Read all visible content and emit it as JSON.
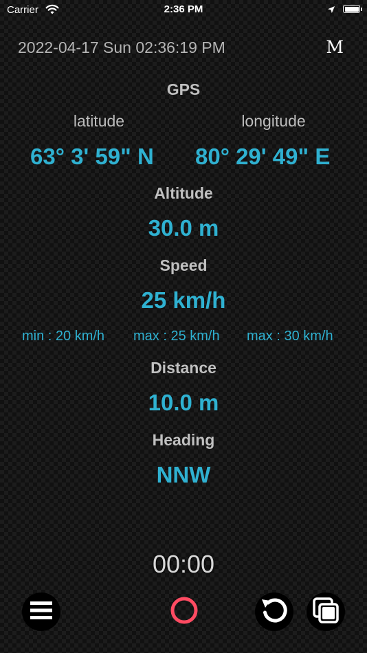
{
  "status_bar": {
    "carrier": "Carrier",
    "time": "2:36 PM"
  },
  "header": {
    "datetime": "2022-04-17 Sun 02:36:19 PM",
    "mode_button": "M"
  },
  "gps": {
    "title": "GPS",
    "latitude_label": "latitude",
    "longitude_label": "longitude",
    "latitude_value": "63° 3' 59\" N",
    "longitude_value": "80° 29' 49\" E"
  },
  "altitude": {
    "label": "Altitude",
    "value": "30.0 m"
  },
  "speed": {
    "label": "Speed",
    "value": "25 km/h",
    "min": "min : 20 km/h",
    "avg_max": "max : 25 km/h",
    "max": "max : 30 km/h"
  },
  "distance": {
    "label": "Distance",
    "value": "10.0 m"
  },
  "heading": {
    "label": "Heading",
    "value": "NNW"
  },
  "timer": "00:00",
  "toolbar": {
    "icons": [
      "menu-icon",
      "record-icon",
      "reset-icon",
      "copy-icon"
    ],
    "record_color": "#ff4b62",
    "accent": "#2fb1d1"
  }
}
